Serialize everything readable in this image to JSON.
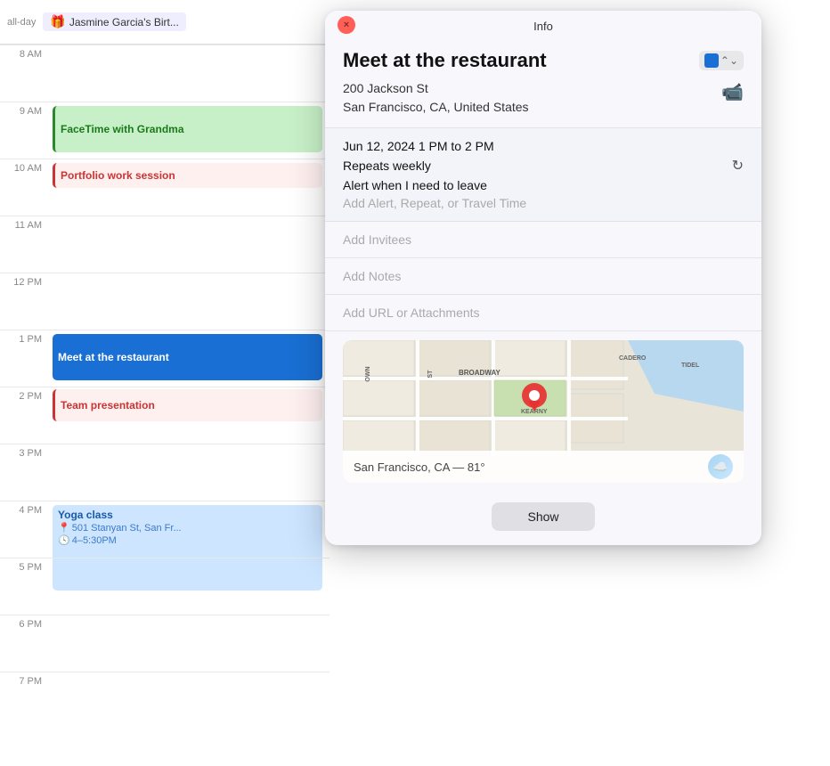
{
  "calendar": {
    "allday_label": "all-day",
    "allday_event": "Jasmine Garcia's Birt...",
    "allday_event_icon": "🎁",
    "times": [
      {
        "label": "8 AM"
      },
      {
        "label": "9 AM"
      },
      {
        "label": "10 AM"
      },
      {
        "label": "11 AM"
      },
      {
        "label": "12 PM"
      },
      {
        "label": "1 PM"
      },
      {
        "label": "2 PM"
      },
      {
        "label": "3 PM"
      },
      {
        "label": "4 PM"
      },
      {
        "label": "5 PM"
      },
      {
        "label": "6 PM"
      },
      {
        "label": "7 PM"
      }
    ],
    "events": {
      "facetime": "FaceTime with Grandma",
      "portfolio": "Portfolio work session",
      "meet_restaurant": "Meet at the restaurant",
      "team_presentation": "Team presentation",
      "yoga": "Yoga class",
      "yoga_address": "501 Stanyan St, San Fr...",
      "yoga_time": "4–5:30PM"
    }
  },
  "popup": {
    "title": "Info",
    "close_label": "×",
    "event_title": "Meet at the restaurant",
    "address_line1": "200 Jackson St",
    "address_line2": "San Francisco, CA, United States",
    "datetime": "Jun 12, 2024  1 PM to 2 PM",
    "repeat": "Repeats weekly",
    "alert": "Alert when I need to leave",
    "add_alert": "Add Alert, Repeat, or Travel Time",
    "add_invitees": "Add Invitees",
    "add_notes": "Add Notes",
    "add_url": "Add URL or Attachments",
    "map_location": "San Francisco, CA — 81°",
    "show_button": "Show",
    "color": "#1a6fd4",
    "map_streets": [
      "BROADWAY",
      "KEARNY",
      "CADERO",
      "TIDEL"
    ]
  }
}
